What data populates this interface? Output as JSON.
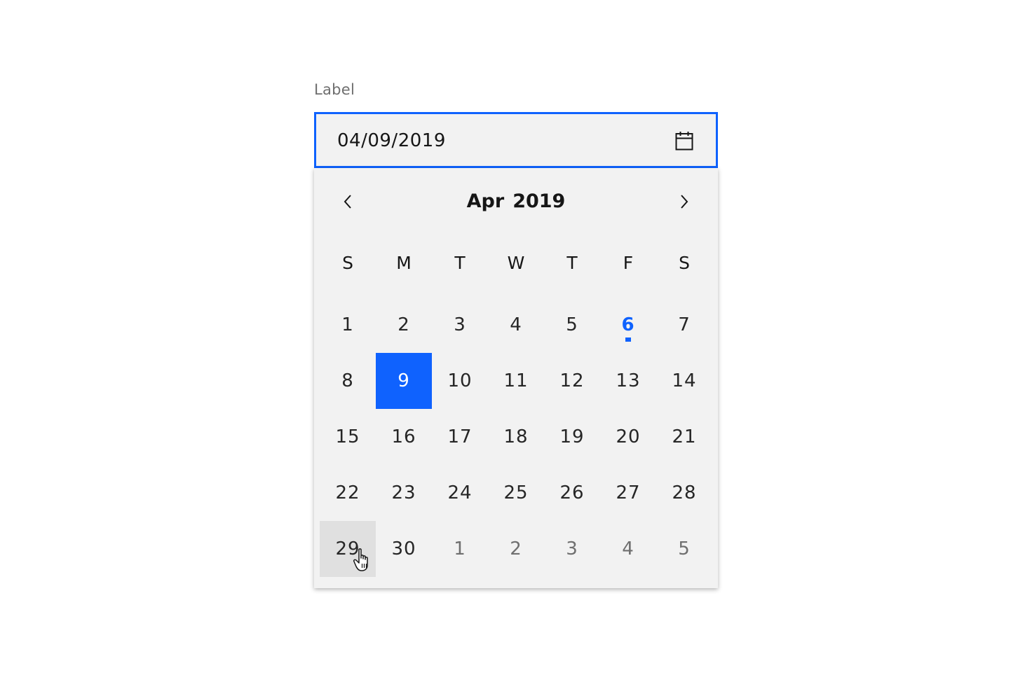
{
  "field": {
    "label": "Label",
    "value": "04/09/2019",
    "icon": "calendar-icon",
    "focus_color": "#0f62fe"
  },
  "calendar": {
    "month": "Apr",
    "year": "2019",
    "prev_icon": "chevron-left-icon",
    "next_icon": "chevron-right-icon",
    "weekdays": [
      "S",
      "M",
      "T",
      "W",
      "T",
      "F",
      "S"
    ],
    "days": [
      {
        "label": "1"
      },
      {
        "label": "2"
      },
      {
        "label": "3"
      },
      {
        "label": "4"
      },
      {
        "label": "5"
      },
      {
        "label": "6",
        "state": "today"
      },
      {
        "label": "7"
      },
      {
        "label": "8"
      },
      {
        "label": "9",
        "state": "selected"
      },
      {
        "label": "10"
      },
      {
        "label": "11"
      },
      {
        "label": "12"
      },
      {
        "label": "13"
      },
      {
        "label": "14"
      },
      {
        "label": "15"
      },
      {
        "label": "16"
      },
      {
        "label": "17"
      },
      {
        "label": "18"
      },
      {
        "label": "19"
      },
      {
        "label": "20"
      },
      {
        "label": "21"
      },
      {
        "label": "22"
      },
      {
        "label": "23"
      },
      {
        "label": "24"
      },
      {
        "label": "25"
      },
      {
        "label": "26"
      },
      {
        "label": "27"
      },
      {
        "label": "28"
      },
      {
        "label": "29",
        "state": "hovered"
      },
      {
        "label": "30"
      },
      {
        "label": "1",
        "state": "other-month"
      },
      {
        "label": "2",
        "state": "other-month"
      },
      {
        "label": "3",
        "state": "other-month"
      },
      {
        "label": "4",
        "state": "other-month"
      },
      {
        "label": "5",
        "state": "other-month"
      }
    ],
    "colors": {
      "selected": "#0f62fe",
      "today": "#0f62fe",
      "hover": "#e0e0e0",
      "other_month": "#6f6f6f"
    }
  }
}
